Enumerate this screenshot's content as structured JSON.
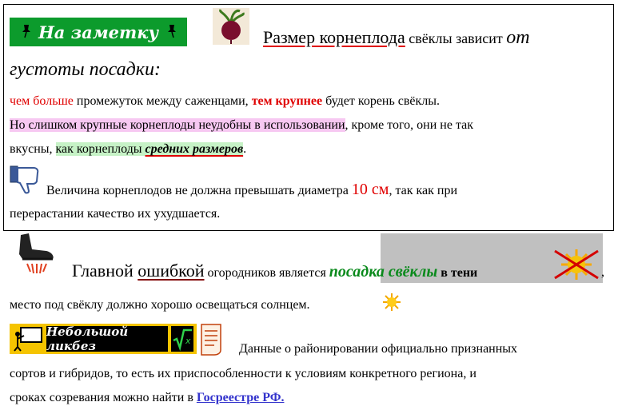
{
  "note_badge": {
    "label": "На заметку"
  },
  "section1": {
    "heading_a": "Размер корнеплода",
    "heading_b": " свёклы зависит ",
    "heading_c": "от",
    "heading_d": "густоты посадки",
    "heading_e": ":",
    "line1_a": "чем больше",
    "line1_b": " промежуток между саженцами,  ",
    "line1_c": "тем крупнее",
    "line1_d": " будет корень свёклы.",
    "line2_a": "Но слишком крупные корнеплоды неудобны в использовании",
    "line2_b": ", кроме того, они не так",
    "line3_a": "вкусны, ",
    "line3_b": "как корнеплоды ",
    "line3_c": "средних размеров",
    "line3_d": ".",
    "line4_a": "Величина корнеплодов не должна превышать диаметра ",
    "line4_b": "10 см",
    "line4_c": ", так как при",
    "line5": "перерастании  качество их ухудшается."
  },
  "section2": {
    "line1_a": "Главной ",
    "line1_b": "ошибкой",
    "line1_c": " огородников является ",
    "line1_d": "посадка свёклы",
    "line1_e": " в тени",
    "line1_f": ",",
    "line2": "место под свёклу должно хорошо освещаться солнцем."
  },
  "edu_badge": {
    "label": "Небольшой ликбез"
  },
  "section3": {
    "line1": "Данные о районировании официально признанных",
    "line2": "сортов и гибридов, то есть их приспособленности к условиям конкретного региона, и",
    "line3_a": "сроках созревания можно найти в ",
    "line3_link": "Госреестре РФ."
  },
  "colors": {
    "accent_red": "#e00000",
    "badge_green": "#0c9b2c",
    "link_blue": "#3333cc",
    "green_text": "#0a8a1c"
  }
}
